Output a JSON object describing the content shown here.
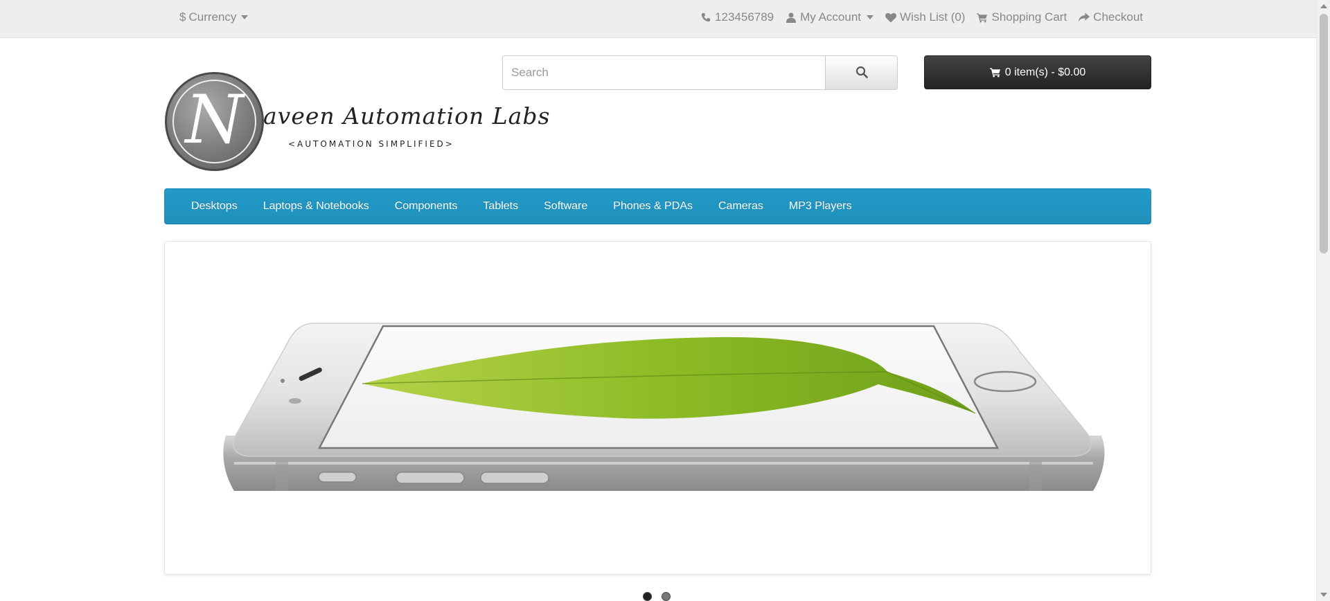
{
  "topbar": {
    "currency_symbol": "$",
    "currency_label": "Currency",
    "phone": "123456789",
    "my_account": "My Account",
    "wishlist": "Wish List (0)",
    "shopping_cart": "Shopping Cart",
    "checkout": "Checkout"
  },
  "logo": {
    "letter": "N",
    "name": "aveen Automation Labs",
    "tagline": "<AUTOMATION SIMPLIFIED>"
  },
  "search": {
    "placeholder": "Search",
    "button_icon": "search-icon"
  },
  "cart": {
    "label": "0 item(s) - $0.00",
    "icon": "shopping-cart-icon"
  },
  "menu": {
    "items": [
      "Desktops",
      "Laptops & Notebooks",
      "Components",
      "Tablets",
      "Software",
      "Phones & PDAs",
      "Cameras",
      "MP3 Players"
    ]
  },
  "slideshow": {
    "slides_count": 2,
    "active_slide": 1
  },
  "colors": {
    "menu_blue": "#229ac8",
    "cart_dark": "#333333",
    "topbar_bg": "#eeeeee"
  }
}
